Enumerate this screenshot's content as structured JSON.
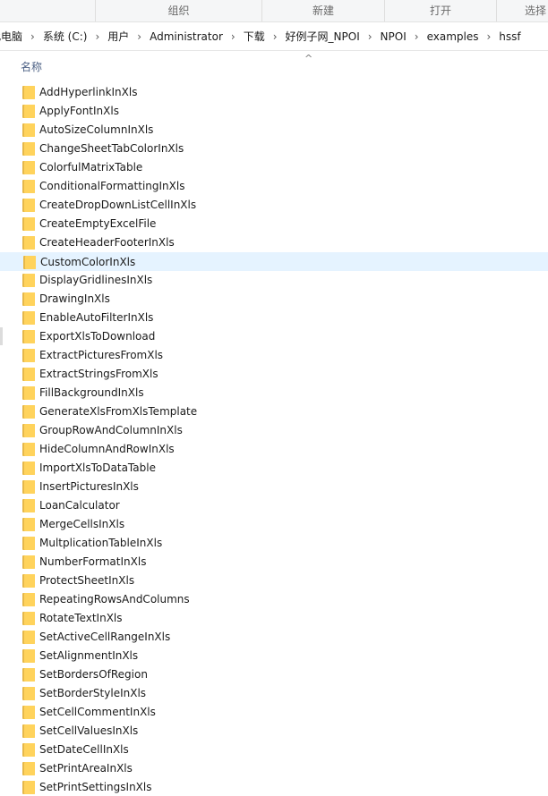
{
  "ribbon": {
    "groups": [
      {
        "label": ""
      },
      {
        "label": "组织"
      },
      {
        "label": "新建"
      },
      {
        "label": "打开"
      },
      {
        "label": "选择"
      }
    ]
  },
  "address": {
    "crumbs": [
      "此电脑",
      "系统 (C:)",
      "用户",
      "Administrator",
      "下载",
      "好例子网_NPOI",
      "NPOI",
      "examples",
      "hssf"
    ],
    "separator": "›"
  },
  "columns": {
    "name": "名称",
    "sort_glyph": "^"
  },
  "files": {
    "folder_icon": "folder-icon",
    "selected_index": 9,
    "colors": {
      "selected_bg": "#e5f3ff",
      "folder_front": "#ffd35c",
      "folder_back": "#e6b84a",
      "header_text": "#4d6185"
    },
    "items": [
      "AddHyperlinkInXls",
      "ApplyFontInXls",
      "AutoSizeColumnInXls",
      "ChangeSheetTabColorInXls",
      "ColorfulMatrixTable",
      "ConditionalFormattingInXls",
      "CreateDropDownListCellInXls",
      "CreateEmptyExcelFile",
      "CreateHeaderFooterInXls",
      "CustomColorInXls",
      "DisplayGridlinesInXls",
      "DrawingInXls",
      "EnableAutoFilterInXls",
      "ExportXlsToDownload",
      "ExtractPicturesFromXls",
      "ExtractStringsFromXls",
      "FillBackgroundInXls",
      "GenerateXlsFromXlsTemplate",
      "GroupRowAndColumnInXls",
      "HideColumnAndRowInXls",
      "ImportXlsToDataTable",
      "InsertPicturesInXls",
      "LoanCalculator",
      "MergeCellsInXls",
      "MultplicationTableInXls",
      "NumberFormatInXls",
      "ProtectSheetInXls",
      "RepeatingRowsAndColumns",
      "RotateTextInXls",
      "SetActiveCellRangeInXls",
      "SetAlignmentInXls",
      "SetBordersOfRegion",
      "SetBorderStyleInXls",
      "SetCellCommentInXls",
      "SetCellValuesInXls",
      "SetDateCellInXls",
      "SetPrintAreaInXls",
      "SetPrintSettingsInXls"
    ]
  }
}
